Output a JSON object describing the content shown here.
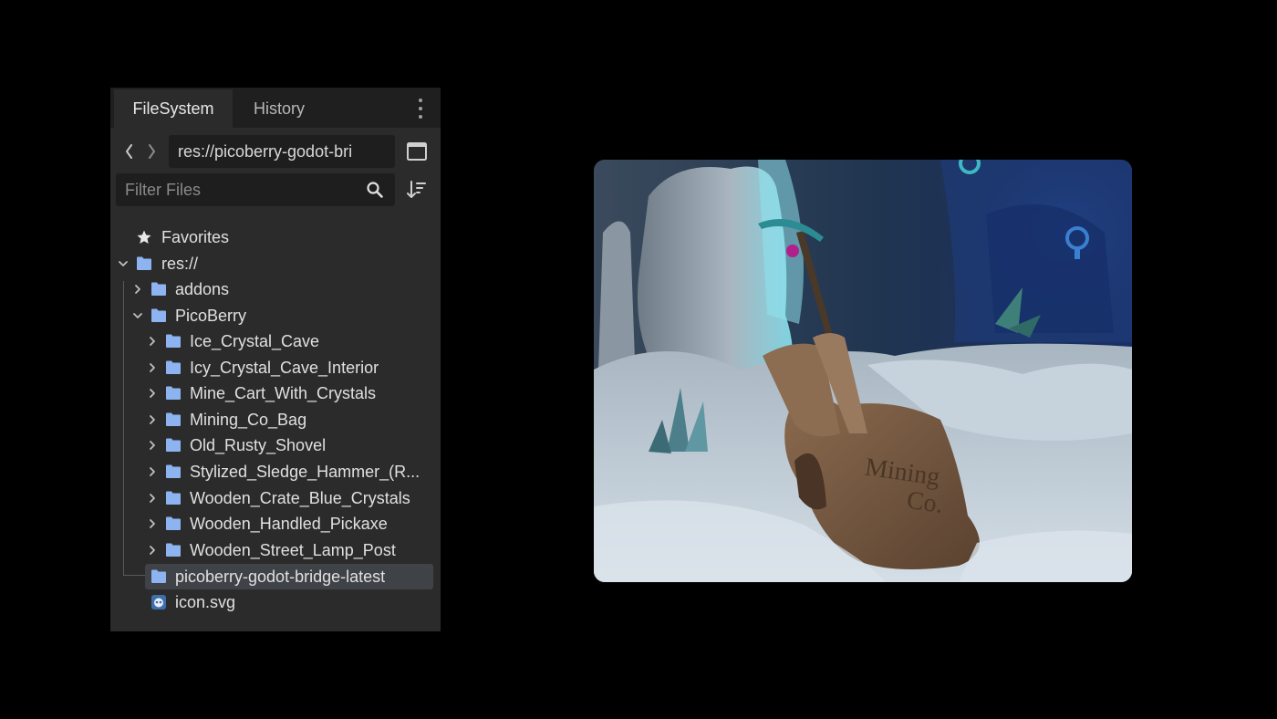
{
  "tabs": [
    {
      "label": "FileSystem",
      "active": true
    },
    {
      "label": "History",
      "active": false
    }
  ],
  "path": {
    "value": "res://picoberry-godot-bri"
  },
  "filter": {
    "placeholder": "Filter Files"
  },
  "tree": {
    "favorites": "Favorites",
    "root": "res://",
    "addons": "addons",
    "picoberry": "PicoBerry",
    "picoberry_children": [
      "Ice_Crystal_Cave",
      "Icy_Crystal_Cave_Interior",
      "Mine_Cart_With_Crystals",
      "Mining_Co_Bag",
      "Old_Rusty_Shovel",
      "Stylized_Sledge_Hammer_(R...",
      "Wooden_Crate_Blue_Crystals",
      "Wooden_Handled_Pickaxe",
      "Wooden_Street_Lamp_Post"
    ],
    "selected_folder": "picoberry-godot-bridge-latest",
    "file": "icon.svg"
  },
  "preview": {
    "bag_text_line1": "Mining",
    "bag_text_line2": "Co."
  },
  "colors": {
    "panel_bg": "#2b2b2b",
    "tabbar_bg": "#1f1f1f",
    "folder_icon": "#8db4f0",
    "selection": "#3f4246"
  }
}
